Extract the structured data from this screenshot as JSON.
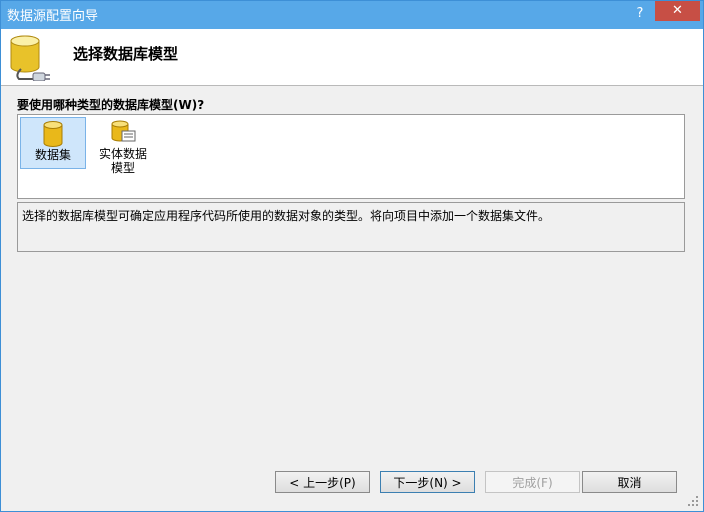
{
  "window": {
    "title": "数据源配置向导",
    "help_label": "?",
    "close_label": "✕"
  },
  "header": {
    "title": "选择数据库模型"
  },
  "question": "要使用哪种类型的数据库模型(W)?",
  "models": [
    {
      "label": "数据集",
      "selected": true,
      "icon": "database-icon"
    },
    {
      "label": "实体数据模型",
      "selected": false,
      "icon": "entity-model-icon"
    }
  ],
  "model_labels": {
    "dataset": "数据集",
    "entity_line1": "实体数据",
    "entity_line2": "模型"
  },
  "description": "选择的数据库模型可确定应用程序代码所使用的数据对象的类型。将向项目中添加一个数据集文件。",
  "buttons": {
    "prev": "< 上一步(P)",
    "next": "下一步(N) >",
    "finish": "完成(F)",
    "cancel": "取消"
  },
  "colors": {
    "titlebar": "#57a8e8",
    "close": "#c74f45",
    "selection": "#cfe6fb"
  }
}
